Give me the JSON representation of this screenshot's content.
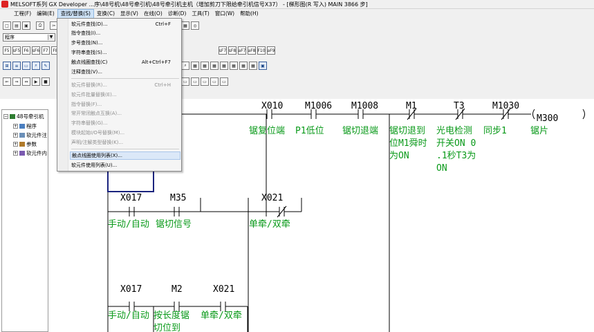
{
  "window": {
    "title": "MELSOFT系列 GX Developer ...序\\48号机\\48号牵引机\\48号牵引机主机（增加剪刀下限给牵引机信号X37） - [梯形图(R 写入)      MAIN     3866 步]"
  },
  "menubar": {
    "items": [
      "工程(F)",
      "编辑(E)",
      "查找/替换(S)",
      "变换(C)",
      "显示(V)",
      "在线(O)",
      "诊断(D)",
      "工具(T)",
      "窗口(W)",
      "帮助(H)"
    ]
  },
  "dropdown": {
    "items": [
      {
        "label": "软元件查找(D)...",
        "shortcut": "Ctrl+F",
        "disabled": false
      },
      {
        "label": "指令查找(I)...",
        "shortcut": "",
        "disabled": false
      },
      {
        "label": "步号查找(N)...",
        "shortcut": "",
        "disabled": false
      },
      {
        "label": "字符串查找(S)...",
        "shortcut": "",
        "disabled": false
      },
      {
        "label": "触点线圈查找(C)",
        "shortcut": "Alt+Ctrl+F7",
        "disabled": false
      },
      {
        "label": "注释查找(V)...",
        "shortcut": "",
        "disabled": false
      },
      {
        "label": "软元件替换(R)...",
        "shortcut": "Ctrl+H",
        "disabled": true
      },
      {
        "label": "软元件批量替换(E)...",
        "shortcut": "",
        "disabled": true
      },
      {
        "label": "指令替换(F)...",
        "shortcut": "",
        "disabled": true
      },
      {
        "label": "常开常闭触点互换(A)...",
        "shortcut": "",
        "disabled": true
      },
      {
        "label": "字符串替换(G)...",
        "shortcut": "",
        "disabled": true
      },
      {
        "label": "模块起始I/O号替换(M)...",
        "shortcut": "",
        "disabled": true
      },
      {
        "label": "声明/注解类型替换(K)...",
        "shortcut": "",
        "disabled": true
      },
      {
        "label": "触点线圈使用列表(X)...",
        "shortcut": "",
        "disabled": false
      },
      {
        "label": "软元件使用列表(U)...",
        "shortcut": "",
        "disabled": false
      }
    ]
  },
  "toolbar": {
    "program_select": "程序",
    "fkeys_row1": [
      "F5",
      "sF5",
      "F6",
      "sF6",
      "F7",
      "F8"
    ],
    "fkeys_row1_right": [
      "sF7",
      "sF8",
      "aF7",
      "aF8",
      "F10",
      "aF9"
    ]
  },
  "tree": {
    "root": "48号牵引机",
    "items": [
      "程序",
      "软元件注",
      "参数",
      "软元件内"
    ]
  },
  "ladder": {
    "row1": {
      "contacts": [
        "X010",
        "M1006",
        "M1008",
        "M1",
        "T3",
        "M1030"
      ],
      "coil": "M300",
      "comments": [
        "锯复位端",
        "P1低位",
        "锯切退端",
        "锯切退到\n位M1舜时\n为ON",
        "光电检测\n开关ON 0\n.1秒T3为\nON",
        "同步1",
        "锯片"
      ]
    },
    "row2": {
      "contacts": [
        "X017",
        "M35",
        "X021"
      ],
      "comments": [
        "手动/自动",
        "锯切信号",
        "单牵/双牵"
      ]
    },
    "row3": {
      "contacts": [
        "X017",
        "M2",
        "X021"
      ],
      "comments": [
        "手动/自动",
        "按长度锯\n切位到",
        "单牵/双牵"
      ]
    }
  },
  "colors": {
    "comment": "#0a9a1a",
    "wire": "#000000",
    "cursor": "#1a237e"
  }
}
